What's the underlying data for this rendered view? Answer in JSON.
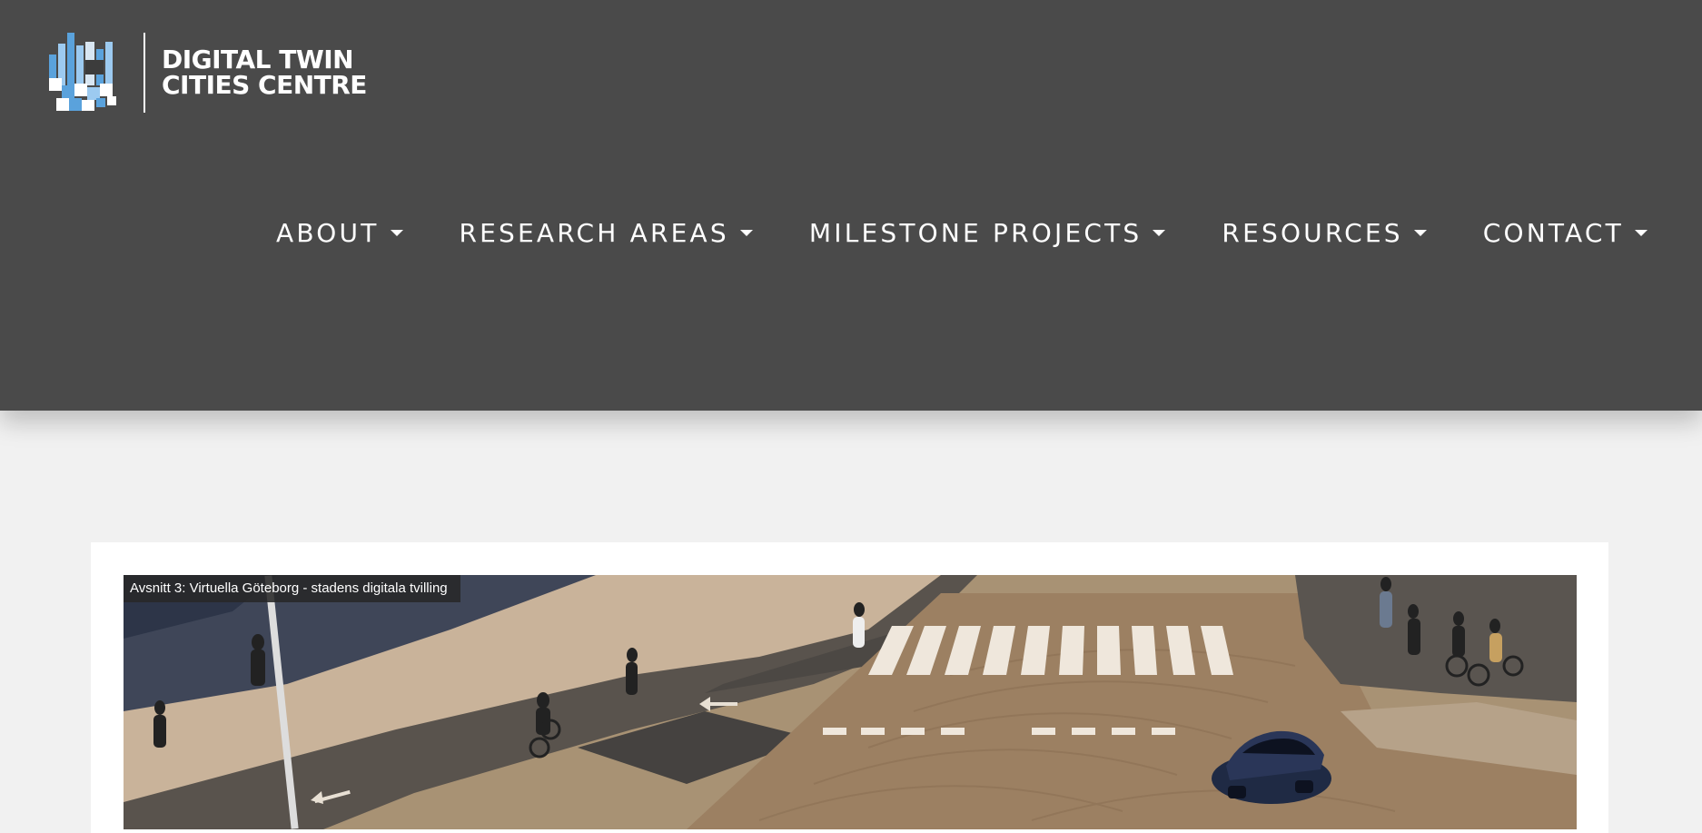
{
  "header": {
    "logo": {
      "line1": "DIGITAL TWIN",
      "line2": "CITIES CENTRE"
    },
    "nav": [
      {
        "label": "ABOUT"
      },
      {
        "label": "RESEARCH AREAS"
      },
      {
        "label": "MILESTONE PROJECTS"
      },
      {
        "label": "RESOURCES"
      },
      {
        "label": "CONTACT"
      }
    ]
  },
  "main": {
    "video": {
      "title": "Avsnitt 3: Virtuella Göteborg - stadens digitala tvilling"
    }
  },
  "colors": {
    "header_bg": "#4a4a4a",
    "page_bg": "#f1f1f1",
    "card_bg": "#ffffff",
    "logo_blue": "#5aa2dc"
  }
}
